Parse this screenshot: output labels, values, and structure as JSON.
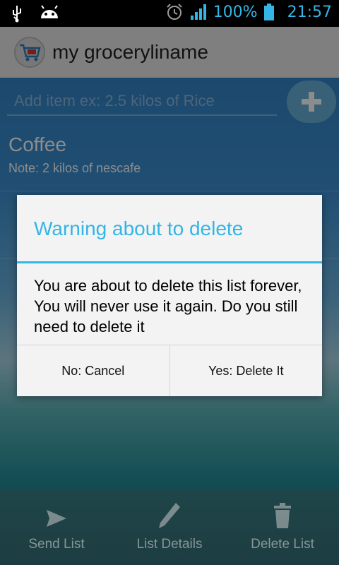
{
  "status_bar": {
    "battery": "100%",
    "time": "21:57",
    "left_icons": [
      "usb-icon",
      "android-icon"
    ],
    "right_icons": [
      "alarm-icon",
      "signal-icon",
      "battery-icon"
    ]
  },
  "action_bar": {
    "title": "my groceryliname",
    "icon": "shopping-cart-icon"
  },
  "add_item": {
    "placeholder": "Add item ex: 2.5 kilos of Rice",
    "value": "",
    "button_icon": "plus-icon"
  },
  "items": [
    {
      "name": "Coffee",
      "note": "Note: 2 kilos of nescafe"
    }
  ],
  "dialog": {
    "title": "Warning about to delete",
    "message": "You are about to delete this list forever, You will never use it again. Do you still need to delete it",
    "cancel_label": "No: Cancel",
    "confirm_label": "Yes: Delete It"
  },
  "bottom_bar": {
    "items": [
      {
        "label": "Send List",
        "icon": "send-icon"
      },
      {
        "label": "List Details",
        "icon": "pencil-icon"
      },
      {
        "label": "Delete List",
        "icon": "trash-icon"
      }
    ]
  },
  "colors": {
    "accent": "#33b5e5",
    "status_text": "#35b5e5"
  }
}
